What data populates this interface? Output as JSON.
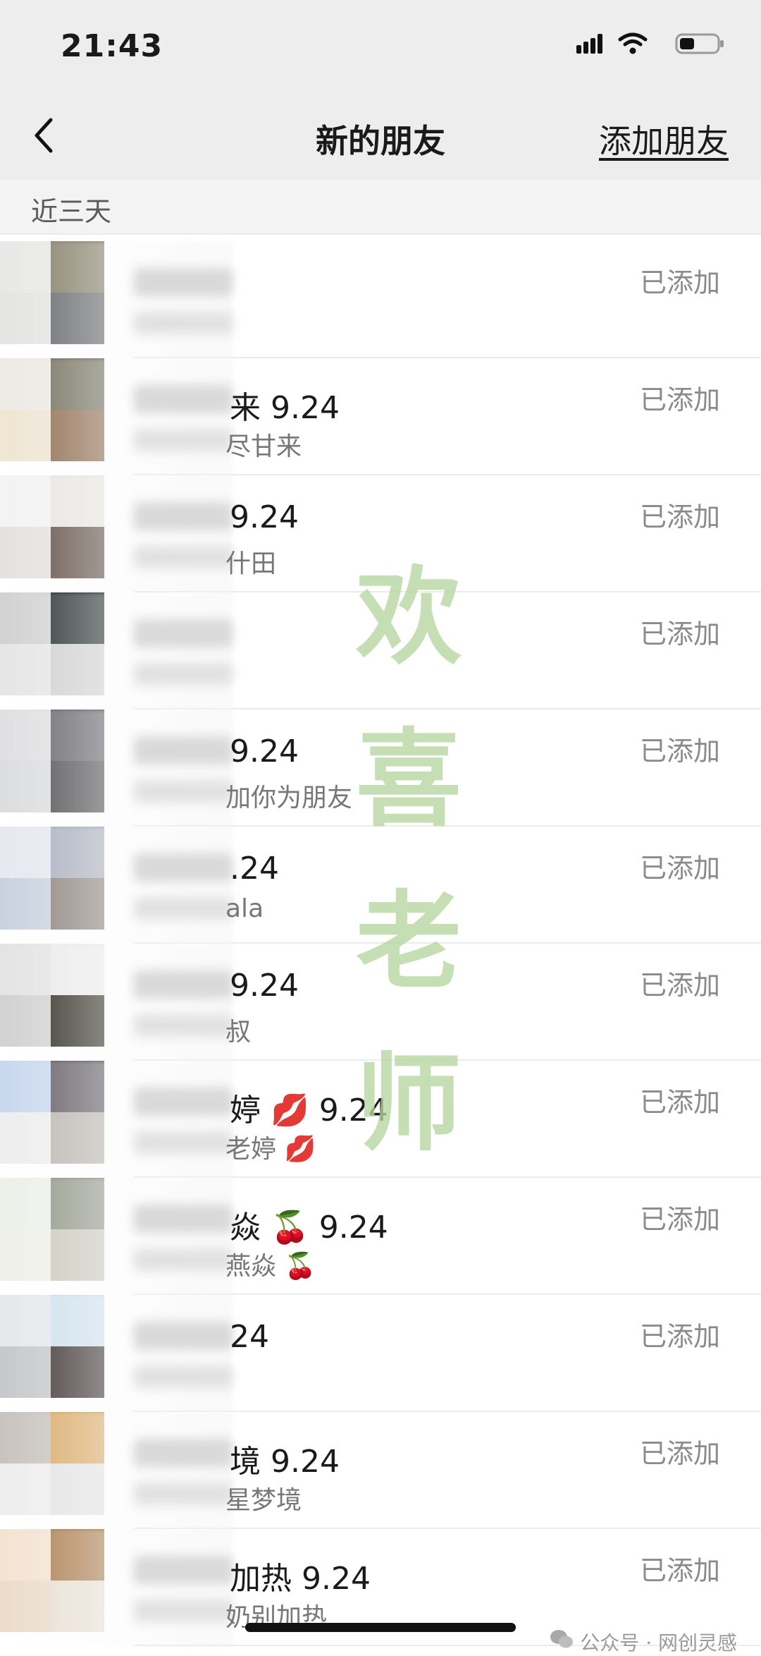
{
  "status": {
    "time": "21:43"
  },
  "nav": {
    "title": "新的朋友",
    "action": "添加朋友"
  },
  "section": {
    "label": "近三天"
  },
  "rows": [
    {
      "name": "",
      "message": "",
      "status": "已添加"
    },
    {
      "name": "来 9.24",
      "message": "尽甘来",
      "status": "已添加"
    },
    {
      "name": " 9.24",
      "message": "什田",
      "status": "已添加"
    },
    {
      "name": "",
      "message": "",
      "status": "已添加"
    },
    {
      "name": " 9.24",
      "message": "加你为朋友",
      "status": "已添加"
    },
    {
      "name": ".24",
      "message": "ala",
      "status": "已添加"
    },
    {
      "name": " 9.24",
      "message": "叔",
      "status": "已添加"
    },
    {
      "name": "婷 💋 9.24",
      "message": "老婷 💋",
      "status": "已添加"
    },
    {
      "name": "焱 🍒 9.24",
      "message": "燕焱 🍒",
      "status": "已添加"
    },
    {
      "name": "24",
      "message": "",
      "status": "已添加"
    },
    {
      "name": "境 9.24",
      "message": "星梦境",
      "status": "已添加"
    },
    {
      "name": "加热 9.24",
      "message": "奶别加热",
      "status": "已添加"
    }
  ],
  "watermark": {
    "chars": [
      "欢",
      "喜",
      "老",
      "师"
    ]
  },
  "footer": {
    "label": "公众号 · 网创灵感"
  },
  "colors": {
    "added_text": "#8a8a8a",
    "watermark": "#b7d69f",
    "bar": "#ededed"
  }
}
